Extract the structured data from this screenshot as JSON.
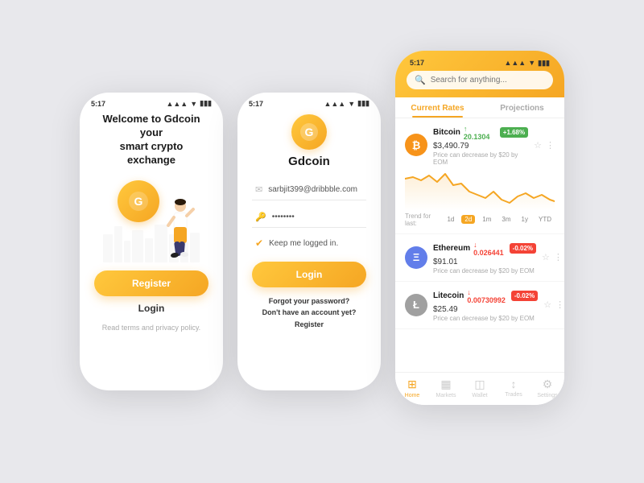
{
  "app": {
    "name": "Gdcoin"
  },
  "phone1": {
    "status_time": "5:17",
    "title_line1": "Welcome to Gdcoin your",
    "title_line2": "smart crypto exchange",
    "register_label": "Register",
    "login_label": "Login",
    "terms_label": "Read terms and privacy policy."
  },
  "phone2": {
    "status_time": "5:17",
    "app_name": "Gdcoin",
    "email_value": "sarbjit399@dribbble.com",
    "email_placeholder": "sarbjit399@dribbble.com",
    "password_value": "••••••••",
    "keep_logged": "Keep me logged in.",
    "login_label": "Login",
    "forgot_password": "Forgot your password?",
    "no_account": "Don't have an account yet?",
    "register_link": "Register"
  },
  "phone3": {
    "status_time": "5:17",
    "search_placeholder": "Search for anything...",
    "tab_current": "Current Rates",
    "tab_projections": "Projections",
    "cryptos": [
      {
        "name": "Bitcoin",
        "symbol": "BTC",
        "price": "$3,490.79",
        "change": "↑ 20.1304",
        "badge": "+1.68%",
        "badge_type": "green",
        "desc": "Price can decrease by $20 by EOM",
        "icon_letter": "₿",
        "icon_class": "btc-icon",
        "show_chart": true,
        "trend_active": "2d",
        "trend_options": [
          "1d",
          "2d",
          "1m",
          "3m",
          "1y",
          "YTD"
        ]
      },
      {
        "name": "Ethereum",
        "symbol": "ETH",
        "price": "$91.01",
        "change": "↓ 0.026441",
        "badge": "-0.02%",
        "badge_type": "red",
        "desc": "Price can decrease by $20 by EOM",
        "icon_letter": "Ξ",
        "icon_class": "eth-icon",
        "show_chart": false,
        "trend_options": []
      },
      {
        "name": "Litecoin",
        "symbol": "LTC",
        "price": "$25.49",
        "change": "↓ 0.00730992",
        "badge": "-0.02%",
        "badge_type": "red",
        "desc": "Price can decrease by $20 by EOM",
        "icon_letter": "Ł",
        "icon_class": "ltc-icon",
        "show_chart": false,
        "trend_options": []
      }
    ],
    "nav": [
      {
        "label": "Home",
        "icon": "⊞",
        "active": true
      },
      {
        "label": "Markets",
        "icon": "▦",
        "active": false
      },
      {
        "label": "Wallet",
        "icon": "◫",
        "active": false
      },
      {
        "label": "Trades",
        "icon": "↕",
        "active": false
      },
      {
        "label": "Settings",
        "icon": "⚙",
        "active": false
      }
    ]
  }
}
